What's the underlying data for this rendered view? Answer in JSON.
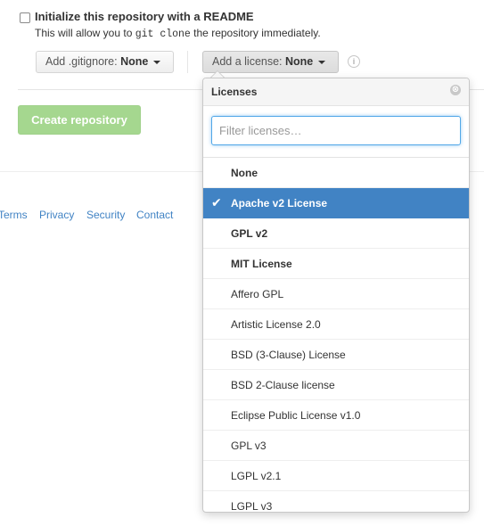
{
  "readme": {
    "label": "Initialize this repository with a README",
    "help_before": "This will allow you to ",
    "help_code": "git clone",
    "help_after": " the repository immediately."
  },
  "gitignore": {
    "prefix": "Add .gitignore: ",
    "value": "None"
  },
  "license": {
    "prefix": "Add a license: ",
    "value": "None"
  },
  "info_icon": "i",
  "create_button": "Create repository",
  "footer": {
    "links": [
      "Terms",
      "Privacy",
      "Security",
      "Contact"
    ]
  },
  "license_dropdown": {
    "title": "Licenses",
    "close_icon": "⊗",
    "filter_placeholder": "Filter licenses…",
    "check_icon": "✔",
    "items": [
      {
        "label": "None",
        "bold": true,
        "selected": false
      },
      {
        "label": "Apache v2 License",
        "bold": true,
        "selected": true
      },
      {
        "label": "GPL v2",
        "bold": true,
        "selected": false
      },
      {
        "label": "MIT License",
        "bold": true,
        "selected": false
      },
      {
        "label": "Affero GPL",
        "bold": false,
        "selected": false
      },
      {
        "label": "Artistic License 2.0",
        "bold": false,
        "selected": false
      },
      {
        "label": "BSD (3-Clause) License",
        "bold": false,
        "selected": false
      },
      {
        "label": "BSD 2-Clause license",
        "bold": false,
        "selected": false
      },
      {
        "label": "Eclipse Public License v1.0",
        "bold": false,
        "selected": false
      },
      {
        "label": "GPL v3",
        "bold": false,
        "selected": false
      },
      {
        "label": "LGPL v2.1",
        "bold": false,
        "selected": false
      },
      {
        "label": "LGPL v3",
        "bold": false,
        "selected": false
      }
    ]
  },
  "colors": {
    "link": "#4183c4",
    "selected_bg": "#4183c4",
    "create_btn_bg": "#a5d78f"
  }
}
